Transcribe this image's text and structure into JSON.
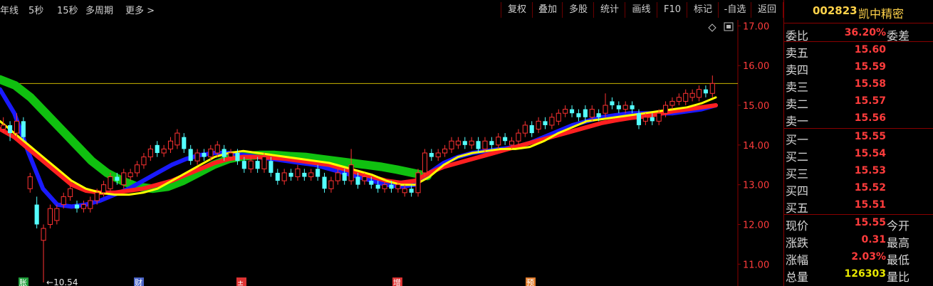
{
  "toolbar": {
    "periods": [
      "年线",
      "5秒",
      "15秒",
      "多周期",
      "更多 >"
    ],
    "tools": [
      "复权",
      "叠加",
      "多股",
      "统计",
      "画线",
      "F10",
      "标记",
      "-自选",
      "返回"
    ]
  },
  "chart_icons": {
    "diamond": "diamond-icon",
    "window": "window-icon"
  },
  "chart_data": {
    "type": "candlestick",
    "yticks": [
      "17.00",
      "16.00",
      "15.00",
      "14.00",
      "13.00",
      "12.00",
      "11.00"
    ],
    "ylim": [
      10.45,
      17.15
    ],
    "reference_price": 15.55,
    "low_marker": {
      "label": "←10.54",
      "value": 10.54
    },
    "event_tags": [
      {
        "label": "胀",
        "color": "#1e9e3a"
      },
      {
        "label": "财",
        "color": "#4a64c8"
      },
      {
        "label": "±",
        "color": "#d33"
      },
      {
        "label": "增",
        "color": "#d33"
      },
      {
        "label": "预",
        "color": "#e07a2a"
      }
    ],
    "candles": [
      [
        14.4,
        14.5,
        14.7,
        14.3
      ],
      [
        14.5,
        14.3,
        14.6,
        14.1
      ],
      [
        14.3,
        14.6,
        14.8,
        14.2
      ],
      [
        14.6,
        14.2,
        14.7,
        14.1
      ],
      [
        12.9,
        13.2,
        13.3,
        12.8
      ],
      [
        12.5,
        12.0,
        12.7,
        11.9
      ],
      [
        11.6,
        11.9,
        12.0,
        10.54
      ],
      [
        12.0,
        12.4,
        12.5,
        11.9
      ],
      [
        12.1,
        12.4,
        12.5,
        12.0
      ],
      [
        12.5,
        12.7,
        12.8,
        12.4
      ],
      [
        12.7,
        12.9,
        13.0,
        12.6
      ],
      [
        12.5,
        12.4,
        12.6,
        12.3
      ],
      [
        12.4,
        12.5,
        12.6,
        12.3
      ],
      [
        12.4,
        12.6,
        12.7,
        12.3
      ],
      [
        12.6,
        12.8,
        12.9,
        12.5
      ],
      [
        12.8,
        13.0,
        13.1,
        12.7
      ],
      [
        12.9,
        13.2,
        13.3,
        12.8
      ],
      [
        13.2,
        13.1,
        13.3,
        13.0
      ],
      [
        13.0,
        13.3,
        13.4,
        12.9
      ],
      [
        13.2,
        13.3,
        13.4,
        13.1
      ],
      [
        13.3,
        13.5,
        13.6,
        13.2
      ],
      [
        13.5,
        13.7,
        13.8,
        13.4
      ],
      [
        13.7,
        13.9,
        14.0,
        13.6
      ],
      [
        14.0,
        13.8,
        14.1,
        13.7
      ],
      [
        13.8,
        13.9,
        14.0,
        13.7
      ],
      [
        13.9,
        14.1,
        14.2,
        13.8
      ],
      [
        14.0,
        14.3,
        14.4,
        13.9
      ],
      [
        14.2,
        13.9,
        14.3,
        13.8
      ],
      [
        13.9,
        13.6,
        14.0,
        13.5
      ],
      [
        13.6,
        13.8,
        13.9,
        13.5
      ],
      [
        13.8,
        13.7,
        13.9,
        13.6
      ],
      [
        13.7,
        13.9,
        14.0,
        13.6
      ],
      [
        13.8,
        14.0,
        14.1,
        13.7
      ],
      [
        13.9,
        13.7,
        14.0,
        13.6
      ],
      [
        13.7,
        13.8,
        13.9,
        13.6
      ],
      [
        13.8,
        13.6,
        13.9,
        13.5
      ],
      [
        13.6,
        13.4,
        13.7,
        13.3
      ],
      [
        13.4,
        13.6,
        13.7,
        13.3
      ],
      [
        13.6,
        13.4,
        13.7,
        13.3
      ],
      [
        13.4,
        13.7,
        13.8,
        13.3
      ],
      [
        13.6,
        13.3,
        13.7,
        13.2
      ],
      [
        13.3,
        13.1,
        13.4,
        13.0
      ],
      [
        13.1,
        13.3,
        13.4,
        13.0
      ],
      [
        13.3,
        13.2,
        13.4,
        13.1
      ],
      [
        13.2,
        13.4,
        13.5,
        13.1
      ],
      [
        13.3,
        13.2,
        13.4,
        13.1
      ],
      [
        13.2,
        13.3,
        13.4,
        13.1
      ],
      [
        13.4,
        13.2,
        13.5,
        13.1
      ],
      [
        13.2,
        12.9,
        13.3,
        12.8
      ],
      [
        12.9,
        13.1,
        13.2,
        12.8
      ],
      [
        13.1,
        13.3,
        13.4,
        13.0
      ],
      [
        13.3,
        13.1,
        13.4,
        13.0
      ],
      [
        13.1,
        13.5,
        13.9,
        13.0
      ],
      [
        13.2,
        13.0,
        13.3,
        12.9
      ],
      [
        13.1,
        13.2,
        13.3,
        13.0
      ],
      [
        13.1,
        13.0,
        13.2,
        12.9
      ],
      [
        13.0,
        12.9,
        13.1,
        12.8
      ],
      [
        12.9,
        13.0,
        13.1,
        12.8
      ],
      [
        13.0,
        12.9,
        13.1,
        12.8
      ],
      [
        12.9,
        13.0,
        13.1,
        12.8
      ],
      [
        12.8,
        12.9,
        13.0,
        12.7
      ],
      [
        12.9,
        12.8,
        13.0,
        12.7
      ],
      [
        12.8,
        13.3,
        13.4,
        12.7
      ],
      [
        13.3,
        13.8,
        13.9,
        13.2
      ],
      [
        13.8,
        13.7,
        13.9,
        13.6
      ],
      [
        13.7,
        13.8,
        13.9,
        13.6
      ],
      [
        13.8,
        13.9,
        14.0,
        13.7
      ],
      [
        13.9,
        14.1,
        14.2,
        13.8
      ],
      [
        14.0,
        14.1,
        14.2,
        13.9
      ],
      [
        14.1,
        14.0,
        14.2,
        13.9
      ],
      [
        14.0,
        14.1,
        14.2,
        13.9
      ],
      [
        14.1,
        13.9,
        14.2,
        13.8
      ],
      [
        13.9,
        14.1,
        14.2,
        13.8
      ],
      [
        14.1,
        14.0,
        14.2,
        13.9
      ],
      [
        14.0,
        14.2,
        14.3,
        13.9
      ],
      [
        14.2,
        14.1,
        14.3,
        14.0
      ],
      [
        14.0,
        14.1,
        14.2,
        13.9
      ],
      [
        14.1,
        14.3,
        14.4,
        14.0
      ],
      [
        14.3,
        14.5,
        14.6,
        14.2
      ],
      [
        14.5,
        14.3,
        14.6,
        14.2
      ],
      [
        14.4,
        14.6,
        14.7,
        14.3
      ],
      [
        14.6,
        14.5,
        14.7,
        14.4
      ],
      [
        14.5,
        14.7,
        14.8,
        14.4
      ],
      [
        14.6,
        14.8,
        14.9,
        14.5
      ],
      [
        14.8,
        14.9,
        15.0,
        14.7
      ],
      [
        14.9,
        14.8,
        15.0,
        14.7
      ],
      [
        14.8,
        14.7,
        14.9,
        14.6
      ],
      [
        14.9,
        14.7,
        15.0,
        14.6
      ],
      [
        14.7,
        14.9,
        15.0,
        14.6
      ],
      [
        14.8,
        14.7,
        14.9,
        14.6
      ],
      [
        14.8,
        15.0,
        15.3,
        14.7
      ],
      [
        15.1,
        15.0,
        15.2,
        14.9
      ],
      [
        15.0,
        14.9,
        15.1,
        14.8
      ],
      [
        14.9,
        15.0,
        15.1,
        14.8
      ],
      [
        15.0,
        14.9,
        15.1,
        14.8
      ],
      [
        14.8,
        14.5,
        14.9,
        14.4
      ],
      [
        14.6,
        14.7,
        14.8,
        14.5
      ],
      [
        14.7,
        14.6,
        14.8,
        14.5
      ],
      [
        14.6,
        14.8,
        14.9,
        14.5
      ],
      [
        14.8,
        15.0,
        15.1,
        14.7
      ],
      [
        15.0,
        15.1,
        15.2,
        14.9
      ],
      [
        15.1,
        15.2,
        15.3,
        15.0
      ],
      [
        15.1,
        15.3,
        15.4,
        15.0
      ],
      [
        15.2,
        15.3,
        15.4,
        15.1
      ],
      [
        15.2,
        15.4,
        15.5,
        15.1
      ],
      [
        15.4,
        15.3,
        15.5,
        15.2
      ],
      [
        15.3,
        15.55,
        15.75,
        15.2
      ]
    ],
    "series": [
      {
        "color": "#ffff00",
        "values": [
          14.6,
          14.3,
          14.0,
          13.7,
          13.4,
          13.1,
          12.9,
          12.8,
          12.75,
          12.75,
          12.8,
          12.9,
          13.1,
          13.3,
          13.5,
          13.7,
          13.8,
          13.85,
          13.8,
          13.75,
          13.7,
          13.65,
          13.6,
          13.55,
          13.45,
          13.35,
          13.25,
          13.1,
          13.0,
          13.0,
          13.2,
          13.5,
          13.7,
          13.8,
          13.85,
          13.9,
          13.9,
          13.95,
          14.1,
          14.3,
          14.45,
          14.6,
          14.65,
          14.7,
          14.75,
          14.8,
          14.85,
          14.9,
          14.95,
          15.05,
          15.2
        ]
      },
      {
        "color": "#ff2020",
        "width": 6,
        "values": [
          14.4,
          14.2,
          13.9,
          13.6,
          13.3,
          13.0,
          12.85,
          12.8,
          12.8,
          12.85,
          12.9,
          13.0,
          13.1,
          13.25,
          13.4,
          13.55,
          13.65,
          13.7,
          13.7,
          13.68,
          13.65,
          13.6,
          13.55,
          13.5,
          13.4,
          13.3,
          13.2,
          13.1,
          13.05,
          13.1,
          13.3,
          13.45,
          13.55,
          13.65,
          13.75,
          13.85,
          13.95,
          14.05,
          14.15,
          14.25,
          14.35,
          14.45,
          14.55,
          14.62,
          14.68,
          14.72,
          14.78,
          14.85,
          14.9,
          14.95,
          15.0
        ]
      },
      {
        "color": "#1a1aff",
        "width": 6,
        "values": [
          15.4,
          14.8,
          13.8,
          12.9,
          12.5,
          12.45,
          12.5,
          12.6,
          12.75,
          12.9,
          13.1,
          13.3,
          13.5,
          13.65,
          13.75,
          13.8,
          13.8,
          13.75,
          13.7,
          13.65,
          13.6,
          13.55,
          13.5,
          13.4,
          13.3,
          13.2,
          13.1,
          13.0,
          12.95,
          13.0,
          13.3,
          13.55,
          13.7,
          13.8,
          13.85,
          13.9,
          13.95,
          14.05,
          14.2,
          14.35,
          14.5,
          14.6,
          14.7,
          14.75,
          14.8,
          14.8,
          14.8,
          14.8,
          14.85,
          14.9,
          15.0
        ]
      },
      {
        "color": "#10c010",
        "width": 12,
        "values": [
          15.65,
          15.5,
          15.2,
          14.8,
          14.4,
          14.0,
          13.6,
          13.3,
          13.1,
          12.95,
          12.9,
          12.95,
          13.1,
          13.3,
          13.5,
          13.65,
          13.72,
          13.75,
          13.75,
          13.72,
          13.7,
          13.65,
          13.6,
          13.55,
          13.5,
          13.45,
          13.38,
          13.3,
          13.22
        ]
      }
    ]
  },
  "panel": {
    "stock_code": "002823",
    "stock_name": "凯中精密",
    "weibi_label": "委比",
    "weibi_value": "36.20%",
    "weicha_label": "委差",
    "sells": [
      {
        "label": "卖五",
        "price": "15.60"
      },
      {
        "label": "卖四",
        "price": "15.59"
      },
      {
        "label": "卖三",
        "price": "15.58"
      },
      {
        "label": "卖二",
        "price": "15.57"
      },
      {
        "label": "卖一",
        "price": "15.56"
      }
    ],
    "buys": [
      {
        "label": "买一",
        "price": "15.55"
      },
      {
        "label": "买二",
        "price": "15.54"
      },
      {
        "label": "买三",
        "price": "15.53"
      },
      {
        "label": "买四",
        "price": "15.52"
      },
      {
        "label": "买五",
        "price": "15.51"
      }
    ],
    "stats": [
      {
        "label": "现价",
        "value": "15.55",
        "label2": "今开",
        "color": "#ff3c3c"
      },
      {
        "label": "涨跌",
        "value": "0.31",
        "label2": "最高",
        "color": "#ff3c3c"
      },
      {
        "label": "涨幅",
        "value": "2.03%",
        "label2": "最低",
        "color": "#ff3c3c"
      },
      {
        "label": "总量",
        "value": "126303",
        "label2": "量比",
        "color": "#e8e800"
      }
    ]
  }
}
